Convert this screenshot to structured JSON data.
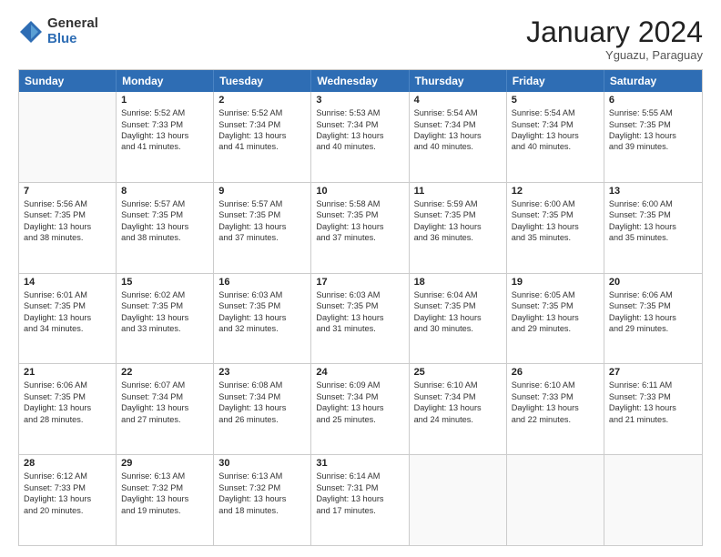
{
  "logo": {
    "general": "General",
    "blue": "Blue"
  },
  "title": "January 2024",
  "subtitle": "Yguazu, Paraguay",
  "header_days": [
    "Sunday",
    "Monday",
    "Tuesday",
    "Wednesday",
    "Thursday",
    "Friday",
    "Saturday"
  ],
  "weeks": [
    [
      {
        "day": "",
        "lines": []
      },
      {
        "day": "1",
        "lines": [
          "Sunrise: 5:52 AM",
          "Sunset: 7:33 PM",
          "Daylight: 13 hours",
          "and 41 minutes."
        ]
      },
      {
        "day": "2",
        "lines": [
          "Sunrise: 5:52 AM",
          "Sunset: 7:34 PM",
          "Daylight: 13 hours",
          "and 41 minutes."
        ]
      },
      {
        "day": "3",
        "lines": [
          "Sunrise: 5:53 AM",
          "Sunset: 7:34 PM",
          "Daylight: 13 hours",
          "and 40 minutes."
        ]
      },
      {
        "day": "4",
        "lines": [
          "Sunrise: 5:54 AM",
          "Sunset: 7:34 PM",
          "Daylight: 13 hours",
          "and 40 minutes."
        ]
      },
      {
        "day": "5",
        "lines": [
          "Sunrise: 5:54 AM",
          "Sunset: 7:34 PM",
          "Daylight: 13 hours",
          "and 40 minutes."
        ]
      },
      {
        "day": "6",
        "lines": [
          "Sunrise: 5:55 AM",
          "Sunset: 7:35 PM",
          "Daylight: 13 hours",
          "and 39 minutes."
        ]
      }
    ],
    [
      {
        "day": "7",
        "lines": [
          "Sunrise: 5:56 AM",
          "Sunset: 7:35 PM",
          "Daylight: 13 hours",
          "and 38 minutes."
        ]
      },
      {
        "day": "8",
        "lines": [
          "Sunrise: 5:57 AM",
          "Sunset: 7:35 PM",
          "Daylight: 13 hours",
          "and 38 minutes."
        ]
      },
      {
        "day": "9",
        "lines": [
          "Sunrise: 5:57 AM",
          "Sunset: 7:35 PM",
          "Daylight: 13 hours",
          "and 37 minutes."
        ]
      },
      {
        "day": "10",
        "lines": [
          "Sunrise: 5:58 AM",
          "Sunset: 7:35 PM",
          "Daylight: 13 hours",
          "and 37 minutes."
        ]
      },
      {
        "day": "11",
        "lines": [
          "Sunrise: 5:59 AM",
          "Sunset: 7:35 PM",
          "Daylight: 13 hours",
          "and 36 minutes."
        ]
      },
      {
        "day": "12",
        "lines": [
          "Sunrise: 6:00 AM",
          "Sunset: 7:35 PM",
          "Daylight: 13 hours",
          "and 35 minutes."
        ]
      },
      {
        "day": "13",
        "lines": [
          "Sunrise: 6:00 AM",
          "Sunset: 7:35 PM",
          "Daylight: 13 hours",
          "and 35 minutes."
        ]
      }
    ],
    [
      {
        "day": "14",
        "lines": [
          "Sunrise: 6:01 AM",
          "Sunset: 7:35 PM",
          "Daylight: 13 hours",
          "and 34 minutes."
        ]
      },
      {
        "day": "15",
        "lines": [
          "Sunrise: 6:02 AM",
          "Sunset: 7:35 PM",
          "Daylight: 13 hours",
          "and 33 minutes."
        ]
      },
      {
        "day": "16",
        "lines": [
          "Sunrise: 6:03 AM",
          "Sunset: 7:35 PM",
          "Daylight: 13 hours",
          "and 32 minutes."
        ]
      },
      {
        "day": "17",
        "lines": [
          "Sunrise: 6:03 AM",
          "Sunset: 7:35 PM",
          "Daylight: 13 hours",
          "and 31 minutes."
        ]
      },
      {
        "day": "18",
        "lines": [
          "Sunrise: 6:04 AM",
          "Sunset: 7:35 PM",
          "Daylight: 13 hours",
          "and 30 minutes."
        ]
      },
      {
        "day": "19",
        "lines": [
          "Sunrise: 6:05 AM",
          "Sunset: 7:35 PM",
          "Daylight: 13 hours",
          "and 29 minutes."
        ]
      },
      {
        "day": "20",
        "lines": [
          "Sunrise: 6:06 AM",
          "Sunset: 7:35 PM",
          "Daylight: 13 hours",
          "and 29 minutes."
        ]
      }
    ],
    [
      {
        "day": "21",
        "lines": [
          "Sunrise: 6:06 AM",
          "Sunset: 7:35 PM",
          "Daylight: 13 hours",
          "and 28 minutes."
        ]
      },
      {
        "day": "22",
        "lines": [
          "Sunrise: 6:07 AM",
          "Sunset: 7:34 PM",
          "Daylight: 13 hours",
          "and 27 minutes."
        ]
      },
      {
        "day": "23",
        "lines": [
          "Sunrise: 6:08 AM",
          "Sunset: 7:34 PM",
          "Daylight: 13 hours",
          "and 26 minutes."
        ]
      },
      {
        "day": "24",
        "lines": [
          "Sunrise: 6:09 AM",
          "Sunset: 7:34 PM",
          "Daylight: 13 hours",
          "and 25 minutes."
        ]
      },
      {
        "day": "25",
        "lines": [
          "Sunrise: 6:10 AM",
          "Sunset: 7:34 PM",
          "Daylight: 13 hours",
          "and 24 minutes."
        ]
      },
      {
        "day": "26",
        "lines": [
          "Sunrise: 6:10 AM",
          "Sunset: 7:33 PM",
          "Daylight: 13 hours",
          "and 22 minutes."
        ]
      },
      {
        "day": "27",
        "lines": [
          "Sunrise: 6:11 AM",
          "Sunset: 7:33 PM",
          "Daylight: 13 hours",
          "and 21 minutes."
        ]
      }
    ],
    [
      {
        "day": "28",
        "lines": [
          "Sunrise: 6:12 AM",
          "Sunset: 7:33 PM",
          "Daylight: 13 hours",
          "and 20 minutes."
        ]
      },
      {
        "day": "29",
        "lines": [
          "Sunrise: 6:13 AM",
          "Sunset: 7:32 PM",
          "Daylight: 13 hours",
          "and 19 minutes."
        ]
      },
      {
        "day": "30",
        "lines": [
          "Sunrise: 6:13 AM",
          "Sunset: 7:32 PM",
          "Daylight: 13 hours",
          "and 18 minutes."
        ]
      },
      {
        "day": "31",
        "lines": [
          "Sunrise: 6:14 AM",
          "Sunset: 7:31 PM",
          "Daylight: 13 hours",
          "and 17 minutes."
        ]
      },
      {
        "day": "",
        "lines": []
      },
      {
        "day": "",
        "lines": []
      },
      {
        "day": "",
        "lines": []
      }
    ]
  ]
}
